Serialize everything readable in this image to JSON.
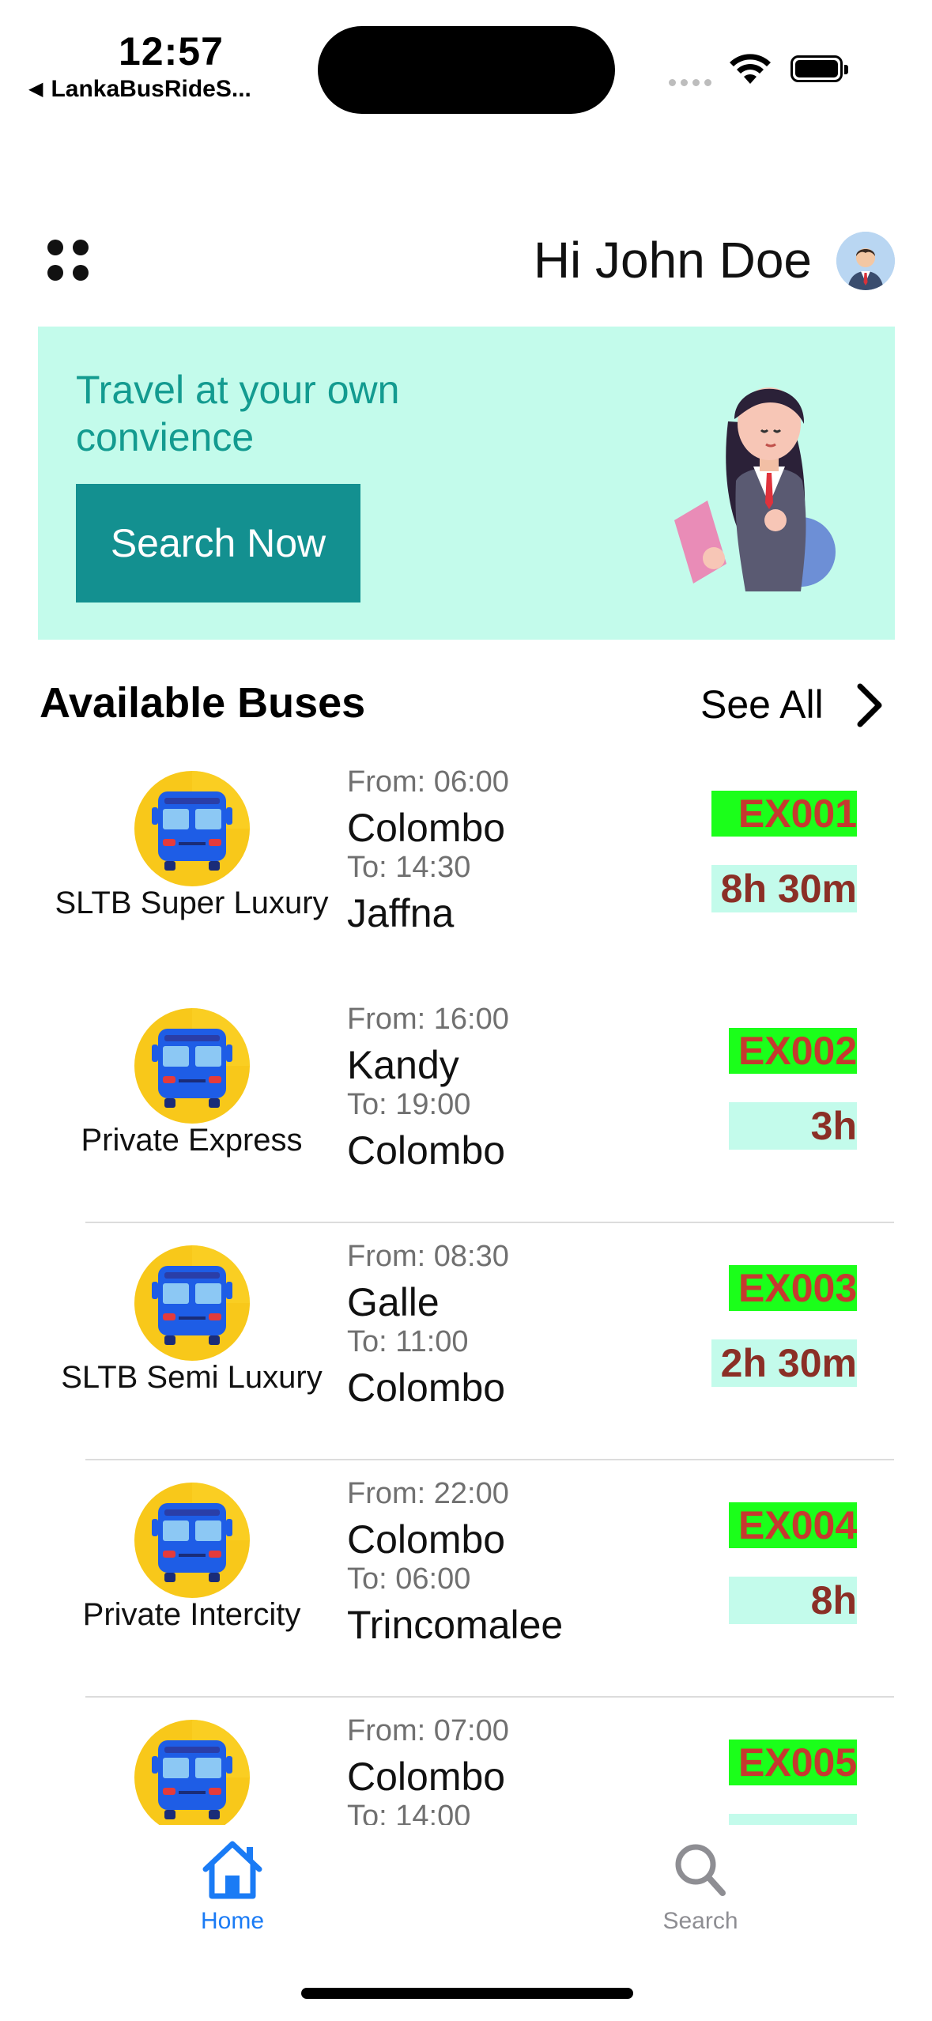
{
  "status_bar": {
    "time": "12:57",
    "back_app": "LankaBusRideS...",
    "icons": [
      "cellular-icon",
      "wifi-icon",
      "battery-icon"
    ]
  },
  "header": {
    "greeting": "Hi John Doe",
    "menu_icon": "grid-dots-icon",
    "avatar_icon": "user-avatar-icon"
  },
  "banner": {
    "text": "Travel at your own convience",
    "button_label": "Search Now",
    "illustration": "traveler-girl-illustration",
    "background": "#c3fbeb",
    "button_color": "#139090"
  },
  "section": {
    "title": "Available Buses",
    "see_all": "See All"
  },
  "buses": [
    {
      "operator": "SLTB Super Luxury",
      "from_time": "From: 06:00",
      "from_city": "Colombo",
      "to_time": "To: 14:30",
      "to_city": "Jaffna",
      "code": "EX001",
      "duration": "8h 30m"
    },
    {
      "operator": "Private Express",
      "from_time": "From: 16:00",
      "from_city": "Kandy",
      "to_time": "To: 19:00",
      "to_city": "Colombo",
      "code": "EX002",
      "duration": "3h"
    },
    {
      "operator": "SLTB Semi Luxury",
      "from_time": "From: 08:30",
      "from_city": "Galle",
      "to_time": "To: 11:00",
      "to_city": "Colombo",
      "code": "EX003",
      "duration": "2h 30m"
    },
    {
      "operator": "Private Intercity",
      "from_time": "From: 22:00",
      "from_city": "Colombo",
      "to_time": "To: 06:00",
      "to_city": "Trincomalee",
      "code": "EX004",
      "duration": "8h"
    },
    {
      "operator": "",
      "from_time": "From: 07:00",
      "from_city": "Colombo",
      "to_time": "To: 14:00",
      "to_city": "",
      "code": "EX005",
      "duration": ""
    }
  ],
  "tabs": [
    {
      "label": "Home",
      "icon": "home-icon",
      "active": true
    },
    {
      "label": "Search",
      "icon": "search-icon",
      "active": false
    }
  ],
  "colors": {
    "code_bg": "#1bff1a",
    "code_text": "#c6392f",
    "duration_bg": "#c3fbeb",
    "duration_text": "#8b2f26",
    "tab_active": "#1a7bf5",
    "tab_inactive": "#8e8e93"
  }
}
